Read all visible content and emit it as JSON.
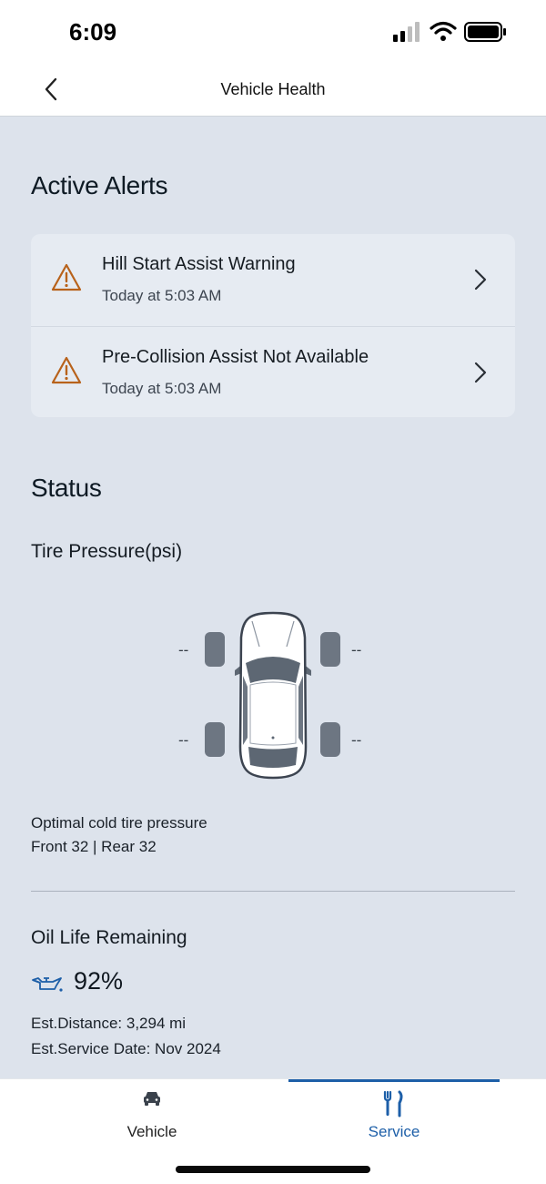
{
  "status_bar": {
    "time": "6:09"
  },
  "nav": {
    "title": "Vehicle Health"
  },
  "alerts": {
    "heading": "Active Alerts",
    "items": [
      {
        "title": "Hill Start Assist Warning",
        "time": "Today at 5:03 AM",
        "icon": "warning-triangle-icon"
      },
      {
        "title": "Pre-Collision Assist Not Available",
        "time": "Today at 5:03 AM",
        "icon": "warning-triangle-icon"
      }
    ]
  },
  "status": {
    "heading": "Status",
    "tire_pressure": {
      "label": "Tire Pressure(psi)",
      "front_left": "--",
      "front_right": "--",
      "rear_left": "--",
      "rear_right": "--",
      "optimal_label": "Optimal cold tire pressure",
      "optimal_values": "Front 32 | Rear 32"
    },
    "oil": {
      "label": "Oil Life Remaining",
      "percent": "92%",
      "est_distance": "Est.Distance: 3,294 mi",
      "est_service": "Est.Service Date: Nov 2024",
      "icon": "oil-can-icon"
    }
  },
  "tabs": [
    {
      "label": "Vehicle",
      "icon": "car-icon",
      "active": false
    },
    {
      "label": "Service",
      "icon": "tools-icon",
      "active": true
    }
  ],
  "colors": {
    "warning": "#b8621b",
    "accent": "#1d5fa8",
    "background": "#dde3ec",
    "card": "#e6ebf2"
  }
}
